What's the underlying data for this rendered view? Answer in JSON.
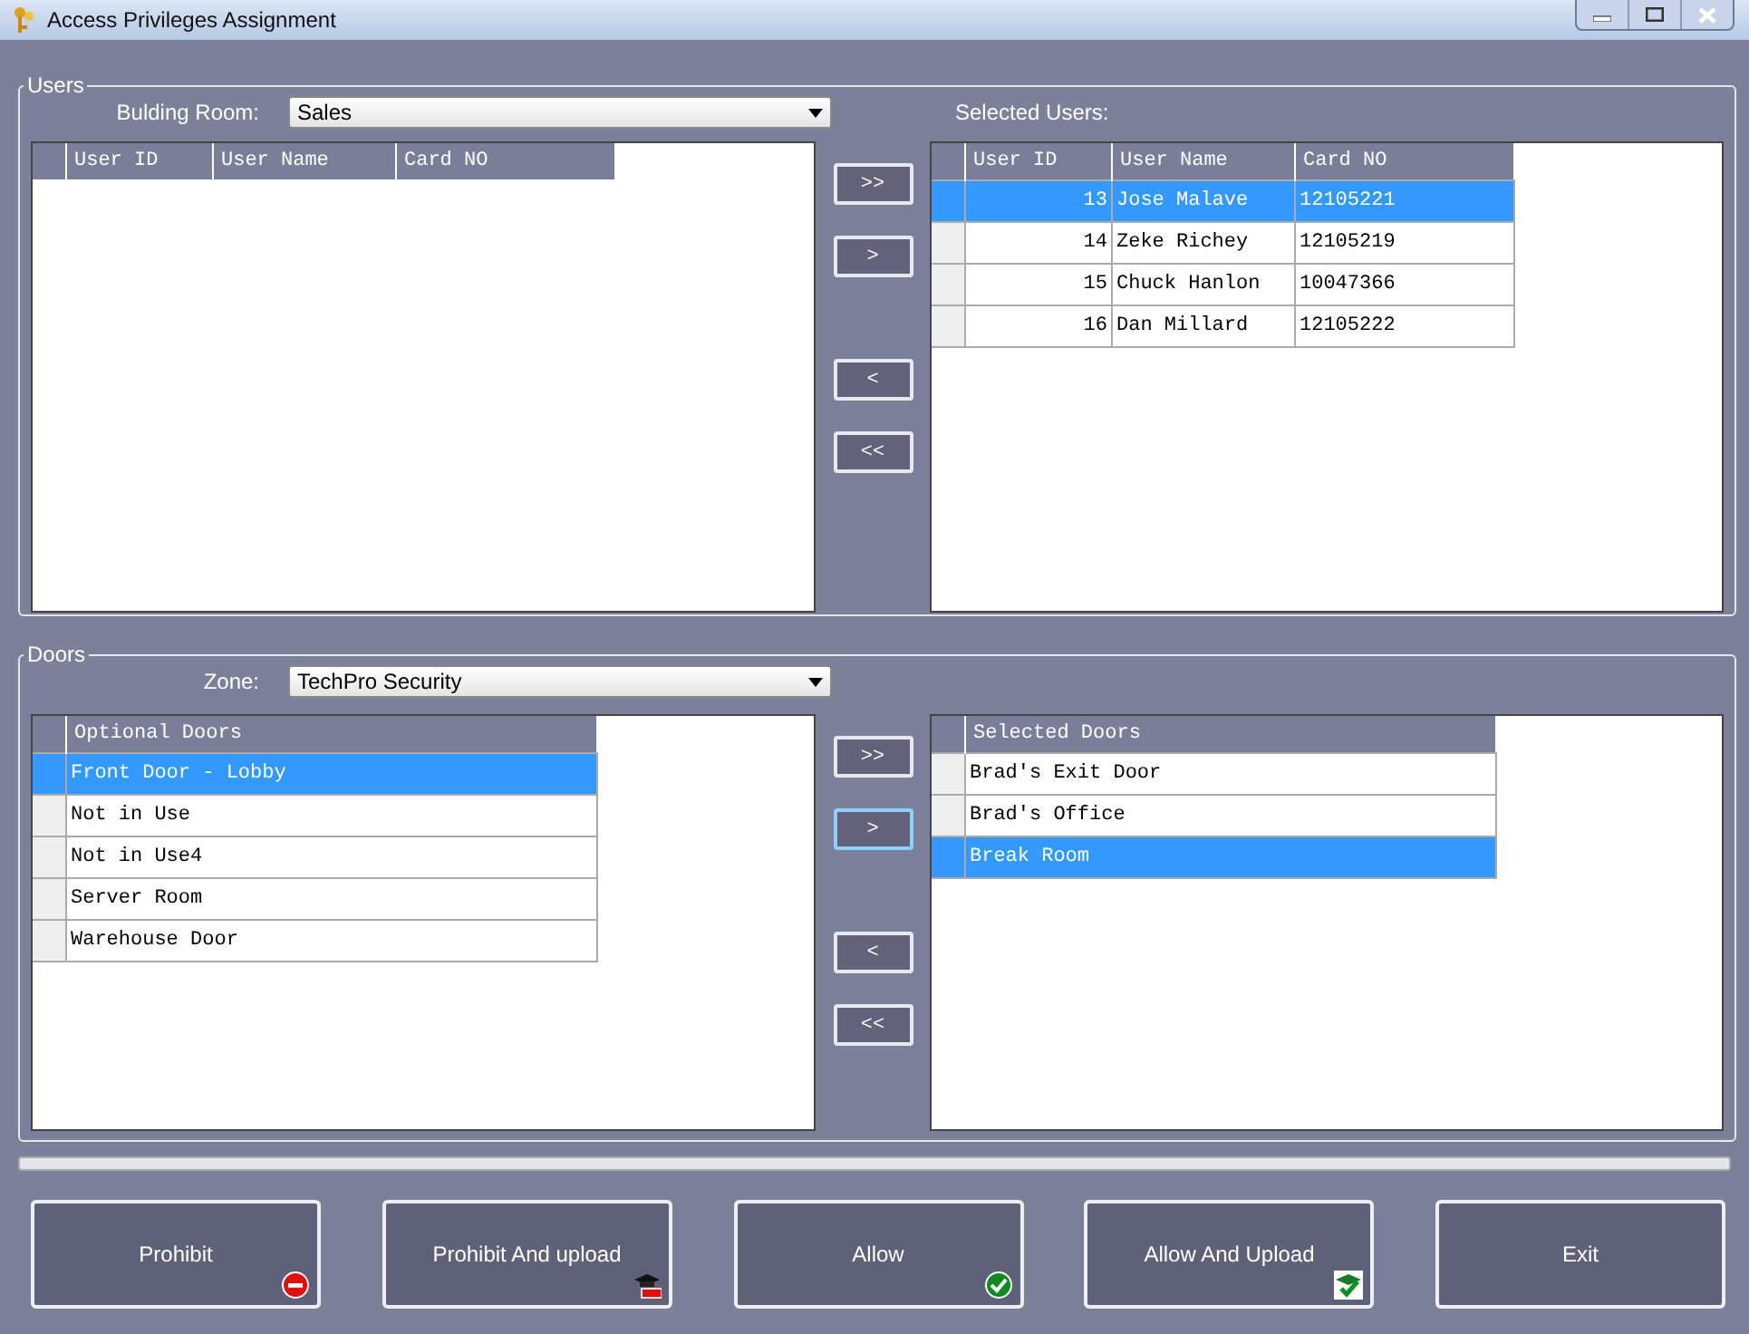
{
  "window": {
    "title": "Access Privileges Assignment"
  },
  "users": {
    "legend": "Users",
    "filter_label": "Bulding Room:",
    "filter_value": "Sales",
    "selected_label": "Selected Users:",
    "available": {
      "columns": [
        "User ID",
        "User Name",
        "Card NO"
      ]
    },
    "move_buttons": [
      {
        "label": ">>",
        "focused": false
      },
      {
        "label": ">",
        "focused": false
      },
      {
        "label": "<",
        "focused": false
      },
      {
        "label": "<<",
        "focused": false
      }
    ],
    "selected": {
      "columns": [
        "User ID",
        "User Name",
        "Card NO"
      ],
      "rows": [
        {
          "cells": [
            "13",
            "Jose Malave",
            "12105221"
          ],
          "selected": true
        },
        {
          "cells": [
            "14",
            "Zeke Richey",
            "12105219"
          ],
          "selected": false
        },
        {
          "cells": [
            "15",
            "Chuck Hanlon",
            "10047366"
          ],
          "selected": false
        },
        {
          "cells": [
            "16",
            "Dan Millard",
            "12105222"
          ],
          "selected": false
        }
      ]
    }
  },
  "doors": {
    "legend": "Doors",
    "filter_label": "Zone:",
    "filter_value": "TechPro Security",
    "available": {
      "columns": [
        "Optional Doors"
      ],
      "rows": [
        {
          "cells": [
            "Front Door - Lobby"
          ],
          "selected": true
        },
        {
          "cells": [
            "Not in Use"
          ],
          "selected": false
        },
        {
          "cells": [
            "Not in Use4"
          ],
          "selected": false
        },
        {
          "cells": [
            "Server Room"
          ],
          "selected": false
        },
        {
          "cells": [
            "Warehouse Door"
          ],
          "selected": false
        }
      ]
    },
    "move_buttons": [
      {
        "label": ">>",
        "focused": false
      },
      {
        "label": ">",
        "focused": true
      },
      {
        "label": "<",
        "focused": false
      },
      {
        "label": "<<",
        "focused": false
      }
    ],
    "selected": {
      "columns": [
        "Selected Doors"
      ],
      "rows": [
        {
          "cells": [
            "Brad's Exit Door"
          ],
          "selected": false
        },
        {
          "cells": [
            "Brad's Office"
          ],
          "selected": false
        },
        {
          "cells": [
            "Break Room"
          ],
          "selected": true
        }
      ]
    }
  },
  "progress": {
    "level": 0
  },
  "actions": [
    {
      "label": "Prohibit",
      "kind": "prohibit"
    },
    {
      "label": "Prohibit And upload",
      "kind": "prohibit-upload"
    },
    {
      "label": "Allow",
      "kind": "allow"
    },
    {
      "label": "Allow And Upload",
      "kind": "allow-upload"
    },
    {
      "label": "Exit",
      "kind": "plain"
    }
  ]
}
